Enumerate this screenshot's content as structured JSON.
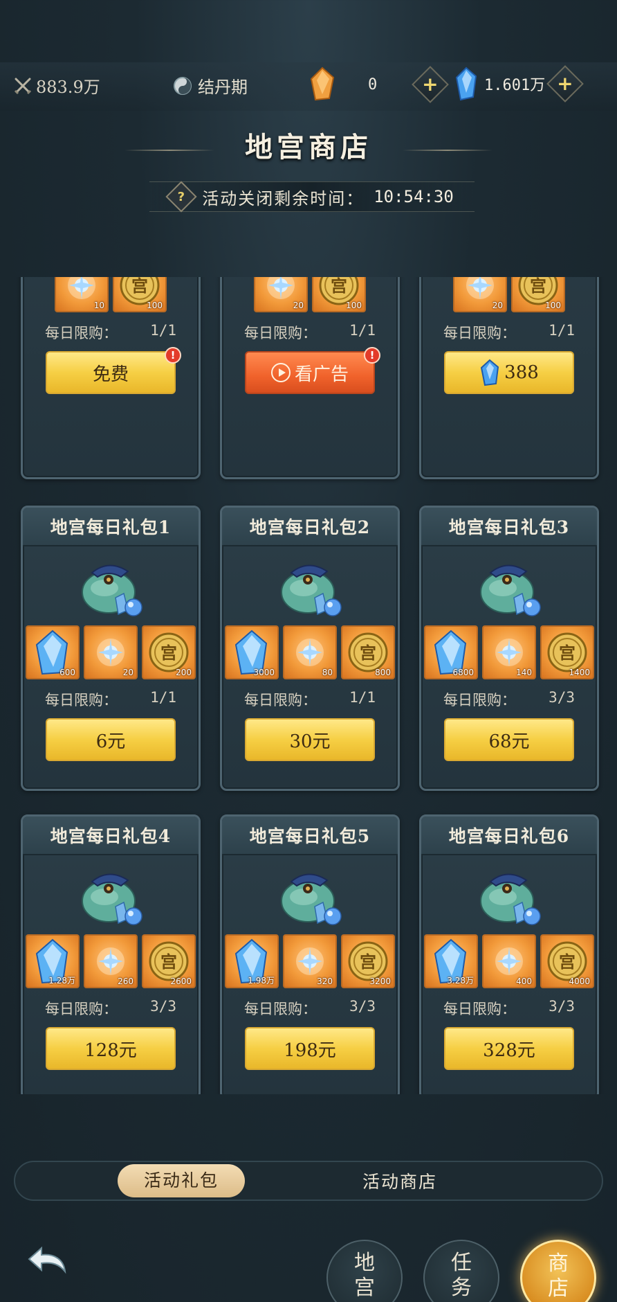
{
  "topbar": {
    "power": "883.9万",
    "stage": "结丹期",
    "amber_count": "0",
    "crystal_count": "1.601万",
    "plus_label": "+"
  },
  "header": {
    "title": "地宫商店",
    "help_label": "?",
    "timer_label": "活动关闭剩余时间：",
    "timer_value": "10:54:30"
  },
  "limit_label": "每日限购：",
  "cards_row1": [
    {
      "items": [
        {
          "icon": "spirit-orb-icon",
          "qty": "10"
        },
        {
          "icon": "palace-coin-icon",
          "qty": "100"
        }
      ],
      "limit": "1/1",
      "button": "免费",
      "button_type": "free",
      "alert": "!"
    },
    {
      "items": [
        {
          "icon": "spirit-orb-icon",
          "qty": "20"
        },
        {
          "icon": "palace-coin-icon",
          "qty": "100"
        }
      ],
      "limit": "1/1",
      "button": "看广告",
      "button_type": "ad",
      "alert": "!"
    },
    {
      "items": [
        {
          "icon": "spirit-orb-icon",
          "qty": "20"
        },
        {
          "icon": "palace-coin-icon",
          "qty": "100"
        }
      ],
      "limit": "1/1",
      "button": "388",
      "button_type": "crystal"
    }
  ],
  "cards": [
    {
      "title": "地宫每日礼包1",
      "items": [
        {
          "icon": "crystal-icon",
          "qty": "600"
        },
        {
          "icon": "spirit-orb-icon",
          "qty": "20"
        },
        {
          "icon": "palace-coin-icon",
          "qty": "200"
        }
      ],
      "limit": "1/1",
      "price": "6元"
    },
    {
      "title": "地宫每日礼包2",
      "items": [
        {
          "icon": "crystal-icon",
          "qty": "3000"
        },
        {
          "icon": "spirit-orb-icon",
          "qty": "80"
        },
        {
          "icon": "palace-coin-icon",
          "qty": "800"
        }
      ],
      "limit": "1/1",
      "price": "30元"
    },
    {
      "title": "地宫每日礼包3",
      "items": [
        {
          "icon": "crystal-icon",
          "qty": "6800"
        },
        {
          "icon": "spirit-orb-icon",
          "qty": "140"
        },
        {
          "icon": "palace-coin-icon",
          "qty": "1400"
        }
      ],
      "limit": "3/3",
      "price": "68元"
    },
    {
      "title": "地宫每日礼包4",
      "items": [
        {
          "icon": "crystal-icon",
          "qty": "1.28万"
        },
        {
          "icon": "spirit-orb-icon",
          "qty": "260"
        },
        {
          "icon": "palace-coin-icon",
          "qty": "2600"
        }
      ],
      "limit": "3/3",
      "price": "128元"
    },
    {
      "title": "地宫每日礼包5",
      "items": [
        {
          "icon": "crystal-icon",
          "qty": "1.98万"
        },
        {
          "icon": "spirit-orb-icon",
          "qty": "320"
        },
        {
          "icon": "palace-coin-icon",
          "qty": "3200"
        }
      ],
      "limit": "3/3",
      "price": "198元"
    },
    {
      "title": "地宫每日礼包6",
      "items": [
        {
          "icon": "crystal-icon",
          "qty": "3.28万"
        },
        {
          "icon": "spirit-orb-icon",
          "qty": "400"
        },
        {
          "icon": "palace-coin-icon",
          "qty": "4000"
        }
      ],
      "limit": "3/3",
      "price": "328元"
    }
  ],
  "tabs": {
    "active": "活动礼包",
    "other": "活动商店"
  },
  "nav": {
    "palace": [
      "地",
      "宫"
    ],
    "task": [
      "任",
      "务"
    ],
    "shop": [
      "商",
      "店"
    ]
  },
  "colors": {
    "button_gold": "#f6cf44",
    "button_ad": "#f0622b",
    "item_bg": "#f29a3a",
    "card_bg": "#24343d"
  }
}
